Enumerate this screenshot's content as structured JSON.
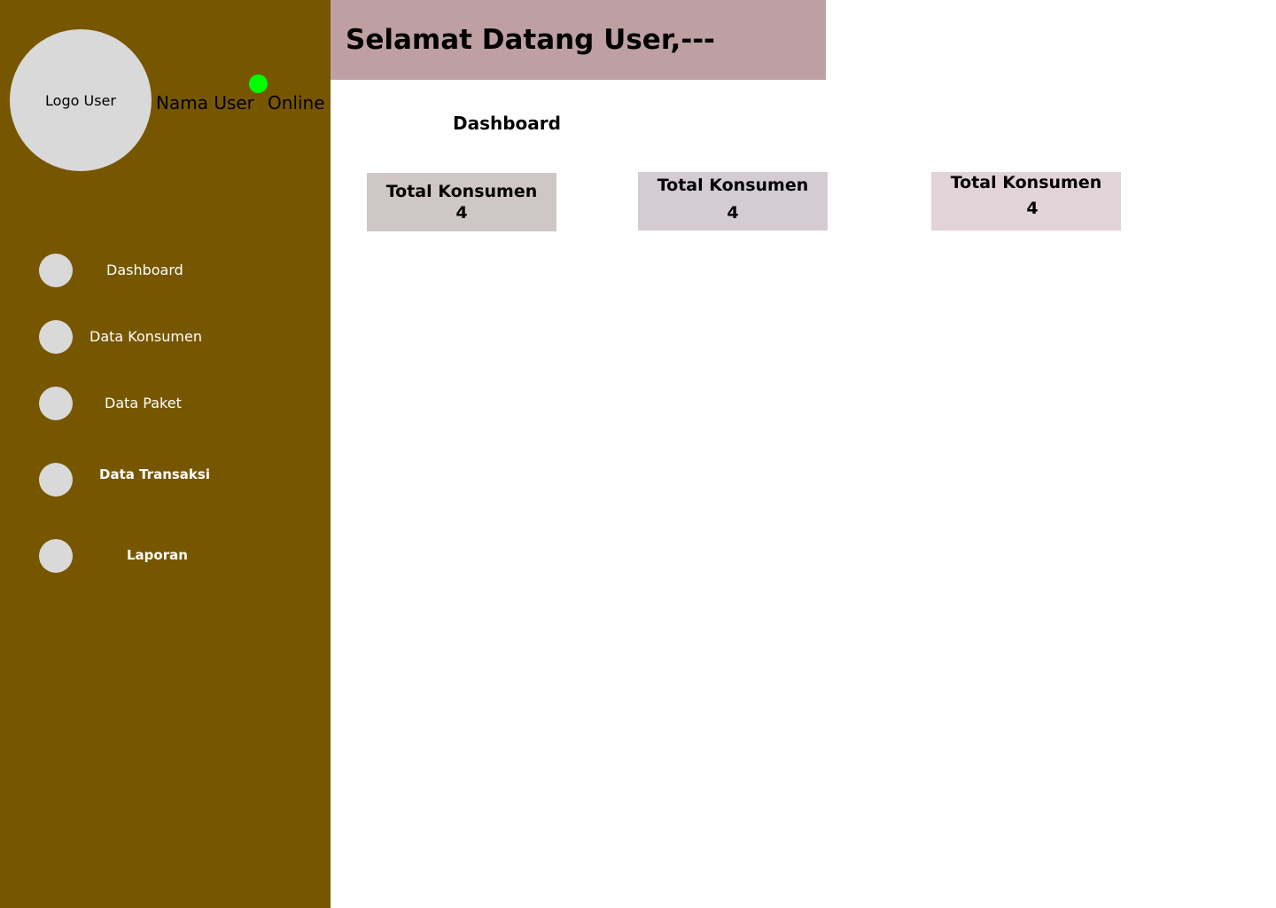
{
  "sidebar": {
    "avatar_label": "Logo User",
    "user_name": "Nama User",
    "status": "Online",
    "status_color": "#00ff00",
    "background_color": "#775600",
    "items": [
      {
        "label": "Dashboard",
        "icon": "circle-icon"
      },
      {
        "label": "Data Konsumen",
        "icon": "circle-icon"
      },
      {
        "label": "Data Paket",
        "icon": "circle-icon"
      },
      {
        "label": "Data Transaksi",
        "icon": "circle-icon"
      },
      {
        "label": "Laporan",
        "icon": "circle-icon"
      }
    ]
  },
  "header": {
    "welcome": "Selamat Datang User,---",
    "background_color": "#bea0a2"
  },
  "main": {
    "section_title": "Dashboard",
    "cards": [
      {
        "label": "Total Konsumen",
        "value": "4",
        "color": "#cfc6c6"
      },
      {
        "label": "Total Konsumen",
        "value": "4",
        "color": "#d5cbd2"
      },
      {
        "label": "Total Konsumen",
        "value": "4",
        "color": "#e2d3d9"
      }
    ]
  }
}
